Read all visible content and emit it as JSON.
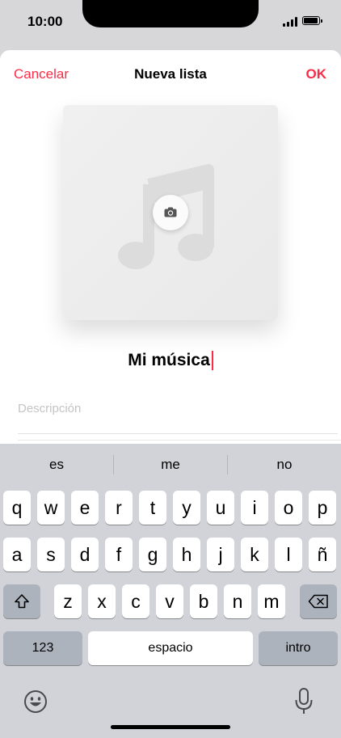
{
  "status_bar": {
    "time": "10:00"
  },
  "header": {
    "cancel_label": "Cancelar",
    "title": "Nueva lista",
    "ok_label": "OK"
  },
  "form": {
    "playlist_name": "Mi música",
    "description_placeholder": "Descripción"
  },
  "keyboard": {
    "suggestions": [
      "es",
      "me",
      "no"
    ],
    "row1": [
      "q",
      "w",
      "e",
      "r",
      "t",
      "y",
      "u",
      "i",
      "o",
      "p"
    ],
    "row2": [
      "a",
      "s",
      "d",
      "f",
      "g",
      "h",
      "j",
      "k",
      "l",
      "ñ"
    ],
    "row3": [
      "z",
      "x",
      "c",
      "v",
      "b",
      "n",
      "m"
    ],
    "numbers_label": "123",
    "space_label": "espacio",
    "return_label": "intro"
  },
  "colors": {
    "accent": "#fa2d48",
    "keyboard_bg": "#d1d3d9",
    "dark_key": "#adb3bd"
  },
  "icons": [
    "signal-icon",
    "battery-icon",
    "music-note-icon",
    "camera-icon",
    "shift-icon",
    "delete-icon",
    "emoji-icon",
    "microphone-icon"
  ]
}
